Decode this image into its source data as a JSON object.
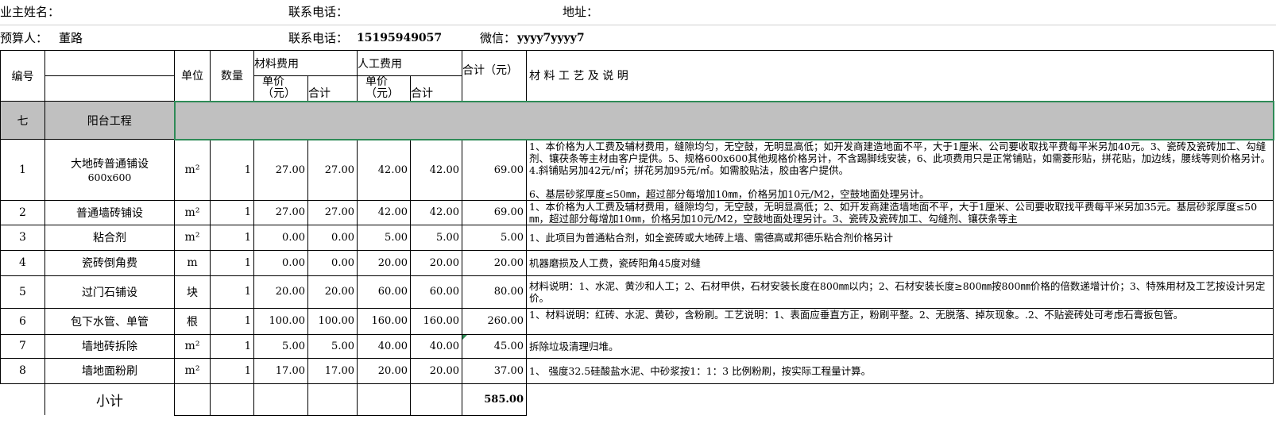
{
  "header": {
    "owner_label": "业主姓名：",
    "phone_label_1": "联系电话：",
    "address_label": "地址：",
    "budget_label": "预算人：",
    "budget_person": "董路",
    "phone_label_2": "联系电话：",
    "phone": "15195949057",
    "wechat_label": "微信：",
    "wechat": "yyyy7yyyy7"
  },
  "table": {
    "col_no": "编号",
    "col_unit": "单位",
    "col_qty": "数量",
    "col_material": "材料费用",
    "col_labor": "人工费用",
    "col_total": "合计（元）",
    "col_desc": "材 料 工 艺 及 说 明",
    "col_unit_price": "单价（元）",
    "col_subtotal": "合计",
    "section_no": "七",
    "section_name": "阳台工程",
    "rows": [
      {
        "no": "1",
        "name": "大地砖普通铺设",
        "sub": "600x600",
        "unit": "m²",
        "qty": "1",
        "mp": "27.00",
        "mt": "27.00",
        "lp": "42.00",
        "lt": "42.00",
        "total": "69.00",
        "desc": "1、本价格为人工费及辅材费用，缝隙均匀，无空鼓，无明显高低；如开发商建造地面不平，大于1厘米、公司要收取找平费每平米另加40元。3、瓷砖及瓷砖加工、勾缝剂、镶茯条等主材由客户提供。5、规格600x600其他规格价格另计，不含踢脚线安装，6、此项费用只是正常铺贴，如需菱形贴，拼花贴，加边线，腰线等则价格另计。4.斜铺贴另加42元/㎡；拼花另加95元/㎡。如需胶贴法，胶由客户提供。",
        "desc2": "6、基层砂浆厚度≤50㎜，超过部分每增加10㎜，价格另加10元/M2，空鼓地面处理另计。"
      },
      {
        "no": "2",
        "name": "普通墙砖铺设",
        "unit": "m²",
        "qty": "1",
        "mp": "27.00",
        "mt": "27.00",
        "lp": "42.00",
        "lt": "42.00",
        "total": "69.00",
        "desc": "1、本价格为人工费及辅材费用，缝隙均匀，无空鼓，无明显高低；2、如开发商建造墙地面不平，大于1厘米、公司要收取找平费每平米另加35元。基层砂浆厚度≤50㎜，超过部分每增加10㎜，价格另加10元/M2，空鼓地面处理另计。3、瓷砖及瓷砖加工、勾缝剂、镶茯条等主"
      },
      {
        "no": "3",
        "name": "粘合剂",
        "unit": "m²",
        "qty": "1",
        "mp": "0.00",
        "mt": "0.00",
        "lp": "5.00",
        "lt": "5.00",
        "total": "5.00",
        "desc": "1、此项目为普通粘合剂，如全瓷砖或大地砖上墙、需德高或邦德乐粘合剂价格另计"
      },
      {
        "no": "4",
        "name": "瓷砖倒角费",
        "unit": "m",
        "qty": "1",
        "mp": "0.00",
        "mt": "0.00",
        "lp": "20.00",
        "lt": "20.00",
        "total": "20.00",
        "desc": "机器磨损及人工费，瓷砖阳角45度对缝"
      },
      {
        "no": "5",
        "name": "过门石铺设",
        "unit": "块",
        "qty": "1",
        "mp": "20.00",
        "mt": "20.00",
        "lp": "60.00",
        "lt": "60.00",
        "total": "80.00",
        "desc": "材料说明：1、水泥、黄沙和人工；2、石材甲供，石材安装长度在800㎜以内；2、石材安装长度≥800㎜按800㎜价格的倍数递增计价；3、特殊用材及工艺按设计另定价。"
      },
      {
        "no": "6",
        "name": "包下水管、单管",
        "unit": "根",
        "qty": "1",
        "mp": "100.00",
        "mt": "100.00",
        "lp": "160.00",
        "lt": "160.00",
        "total": "260.00",
        "desc": "1、材料说明：红砖、水泥、黄砂，含粉刷。工艺说明：1、表面应垂直方正，粉刷平整。2、无脱落、掉灰现象。.2、不贴瓷砖处可考虑石膏扳包管。"
      },
      {
        "no": "7",
        "name": "墙地砖拆除",
        "unit": "m²",
        "qty": "1",
        "mp": "5.00",
        "mt": "5.00",
        "lp": "40.00",
        "lt": "40.00",
        "total": "45.00",
        "desc": "拆除垃圾清理归堆。"
      },
      {
        "no": "8",
        "name": "墙地面粉刷",
        "unit": "m²",
        "qty": "1",
        "mp": "17.00",
        "mt": "17.00",
        "lp": "20.00",
        "lt": "20.00",
        "total": "37.00",
        "desc": "1、 强度32.5硅酸盐水泥、中砂浆按1：1：3  比例粉刷，按实际工程量计算。"
      }
    ],
    "subtotal_label": "小计",
    "subtotal_value": "585.00"
  }
}
